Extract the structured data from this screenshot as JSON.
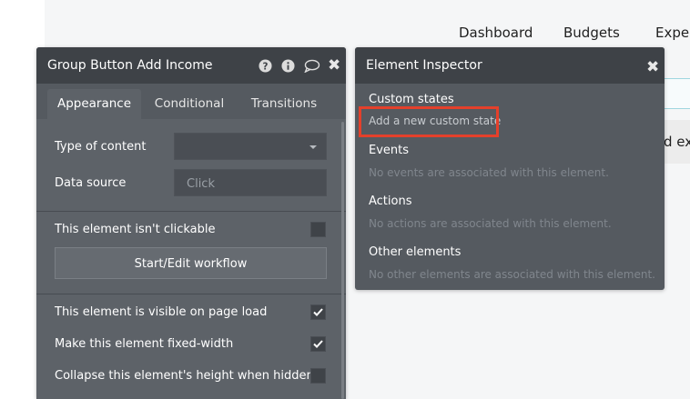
{
  "background": {
    "nav_items": [
      "Dashboard",
      "Budgets",
      "Expe"
    ],
    "card_text": "d exp"
  },
  "property_editor": {
    "title": "Group Button Add Income",
    "header_icons": [
      "help-icon",
      "info-icon",
      "comment-icon",
      "close-icon"
    ],
    "tabs": [
      {
        "label": "Appearance",
        "active": true
      },
      {
        "label": "Conditional",
        "active": false
      },
      {
        "label": "Transitions",
        "active": false
      }
    ],
    "type_of_content": {
      "label": "Type of content",
      "value": ""
    },
    "data_source": {
      "label": "Data source",
      "placeholder": "Click"
    },
    "not_clickable": {
      "label": "This element isn't clickable",
      "checked": false
    },
    "workflow_button": "Start/Edit workflow",
    "checkboxes": [
      {
        "label": "This element is visible on page load",
        "checked": true
      },
      {
        "label": "Make this element fixed-width",
        "checked": true
      },
      {
        "label": "Collapse this element's height when hidden",
        "checked": false
      }
    ]
  },
  "element_inspector": {
    "title": "Element Inspector",
    "custom_states": {
      "heading": "Custom states",
      "link": "Add a new custom state"
    },
    "events": {
      "heading": "Events",
      "note": "No events are associated with this element."
    },
    "actions": {
      "heading": "Actions",
      "note": "No actions are associated with this element."
    },
    "other_elements": {
      "heading": "Other elements",
      "note": "No other elements are associated with this element."
    }
  },
  "colors": {
    "panel_header": "#3e4247",
    "panel_body": "#5d6268",
    "highlight": "#e4402b"
  }
}
